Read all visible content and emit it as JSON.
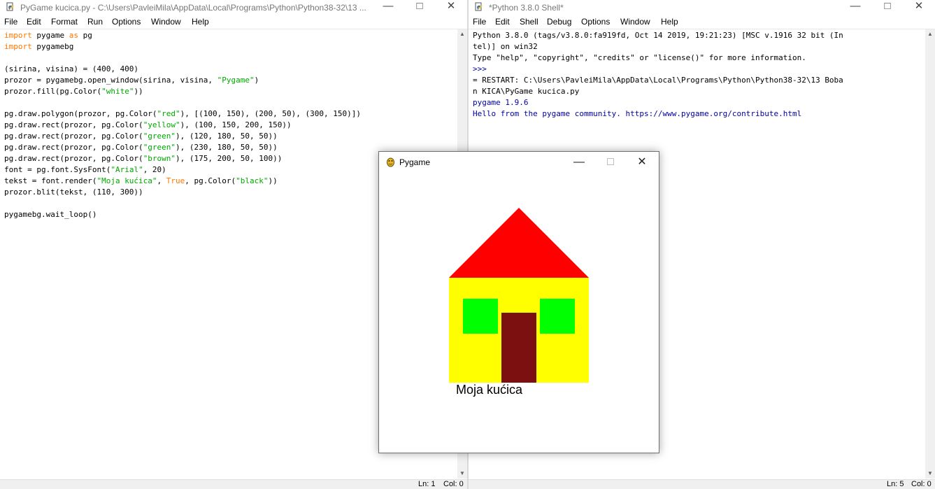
{
  "editor": {
    "title": "PyGame kucica.py - C:\\Users\\PavleiMila\\AppData\\Local\\Programs\\Python\\Python38-32\\13 ...",
    "menu": [
      "File",
      "Edit",
      "Format",
      "Run",
      "Options",
      "Window",
      "Help"
    ],
    "status": {
      "ln": "Ln: 1",
      "col": "Col: 0"
    },
    "code": [
      [
        {
          "t": "import",
          "c": "kw"
        },
        {
          "t": " pygame "
        },
        {
          "t": "as",
          "c": "kw"
        },
        {
          "t": " pg"
        }
      ],
      [
        {
          "t": "import",
          "c": "kw"
        },
        {
          "t": " pygamebg"
        }
      ],
      [],
      [
        {
          "t": "(sirina, visina) = (400, 400)"
        }
      ],
      [
        {
          "t": "prozor = pygamebg.open_window(sirina, visina, "
        },
        {
          "t": "\"Pygame\"",
          "c": "str"
        },
        {
          "t": ")"
        }
      ],
      [
        {
          "t": "prozor.fill(pg.Color("
        },
        {
          "t": "\"white\"",
          "c": "str"
        },
        {
          "t": "))"
        }
      ],
      [],
      [
        {
          "t": "pg.draw.polygon(prozor, pg.Color("
        },
        {
          "t": "\"red\"",
          "c": "str"
        },
        {
          "t": "), [(100, 150), (200, 50), (300, 150)])"
        }
      ],
      [
        {
          "t": "pg.draw.rect(prozor, pg.Color("
        },
        {
          "t": "\"yellow\"",
          "c": "str"
        },
        {
          "t": "), (100, 150, 200, 150))"
        }
      ],
      [
        {
          "t": "pg.draw.rect(prozor, pg.Color("
        },
        {
          "t": "\"green\"",
          "c": "str"
        },
        {
          "t": "), (120, 180, 50, 50))"
        }
      ],
      [
        {
          "t": "pg.draw.rect(prozor, pg.Color("
        },
        {
          "t": "\"green\"",
          "c": "str"
        },
        {
          "t": "), (230, 180, 50, 50))"
        }
      ],
      [
        {
          "t": "pg.draw.rect(prozor, pg.Color("
        },
        {
          "t": "\"brown\"",
          "c": "str"
        },
        {
          "t": "), (175, 200, 50, 100))"
        }
      ],
      [
        {
          "t": "font = pg.font.SysFont("
        },
        {
          "t": "\"Arial\"",
          "c": "str"
        },
        {
          "t": ", 20)"
        }
      ],
      [
        {
          "t": "tekst = font.render("
        },
        {
          "t": "\"Moja kućica\"",
          "c": "str"
        },
        {
          "t": ", "
        },
        {
          "t": "True",
          "c": "kw"
        },
        {
          "t": ", pg.Color("
        },
        {
          "t": "\"black\"",
          "c": "str"
        },
        {
          "t": "))"
        }
      ],
      [
        {
          "t": "prozor.blit(tekst, (110, 300))"
        }
      ],
      [],
      [
        {
          "t": "pygamebg.wait_loop()"
        }
      ]
    ]
  },
  "shell": {
    "title": "*Python 3.8.0 Shell*",
    "menu": [
      "File",
      "Edit",
      "Shell",
      "Debug",
      "Options",
      "Window",
      "Help"
    ],
    "status": {
      "ln": "Ln: 5",
      "col": "Col: 0"
    },
    "lines": [
      [
        {
          "t": "Python 3.8.0 (tags/v3.8.0:fa919fd, Oct 14 2019, 19:21:23) [MSC v.1916 32 bit (In"
        }
      ],
      [
        {
          "t": "tel)] on win32"
        }
      ],
      [
        {
          "t": "Type \"help\", \"copyright\", \"credits\" or \"license()\" for more information."
        }
      ],
      [
        {
          "t": ">>> ",
          "c": "out"
        }
      ],
      [
        {
          "t": "= RESTART: C:\\Users\\PavleiMila\\AppData\\Local\\Programs\\Python\\Python38-32\\13 Boba"
        }
      ],
      [
        {
          "t": "n KICA\\PyGame kucica.py"
        }
      ],
      [
        {
          "t": "pygame 1.9.6",
          "c": "out"
        }
      ],
      [
        {
          "t": "Hello from the pygame community. https://www.pygame.org/contribute.html",
          "c": "out"
        }
      ]
    ]
  },
  "pygame": {
    "title": "Pygame",
    "text": "Moja kućica",
    "colors": {
      "roof": "#ff0000",
      "wall": "#ffff00",
      "window": "#00ff00",
      "door": "#7c1010"
    }
  }
}
